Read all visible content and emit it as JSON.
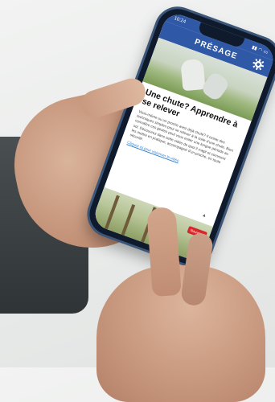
{
  "phone": {
    "status_time": "10:24",
    "status_icons": "▮▮ ◠ ▭",
    "brand": "PRÉSAGE",
    "article": {
      "title": "Une chute? Apprendre à se relever",
      "body": "Vous-même ou un proche avez déjà chuté? Il existe des techniques simples pour se relever à la suite d'une chute. Bien connaître ces gestes peut vous éviter une longue période au sol. Découvrez dans cette vidéo de quoi il s'agit et comment les mettre en pratique, accompagné d'un proche, en toute sécurité.",
      "link": "Cliquez ici pour visionner la vidéo"
    },
    "badge": "Nouveau"
  },
  "icons": {
    "gear": "gear-icon",
    "caret": "caret-up-icon"
  },
  "colors": {
    "header_blue": "#2f58a6",
    "badge_red": "#d9262a"
  }
}
